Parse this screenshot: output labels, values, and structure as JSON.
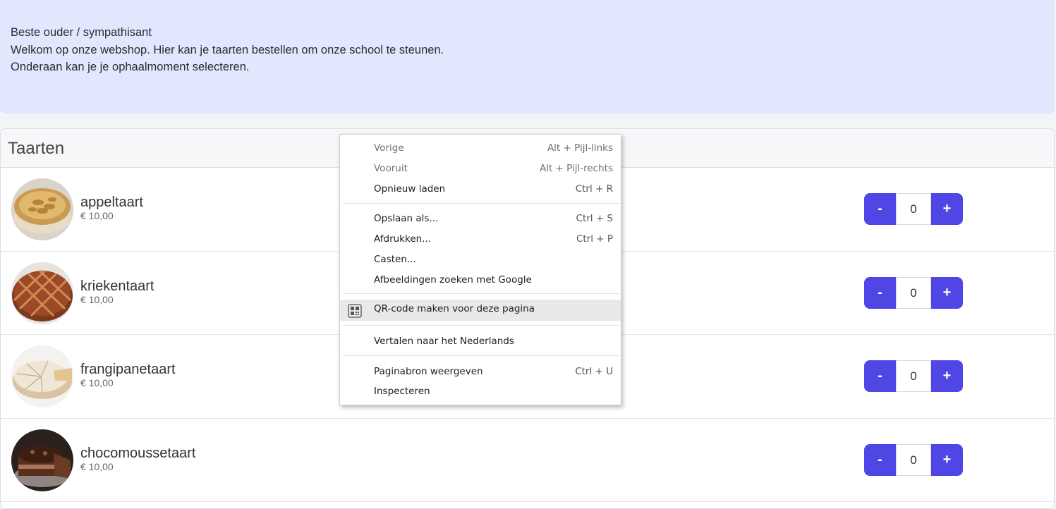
{
  "intro": {
    "lines": [
      "Beste ouder / sympathisant",
      "Welkom op onze webshop. Hier kan je taarten bestellen om onze school te steunen.",
      "Onderaan kan je je ophaalmoment selecteren."
    ]
  },
  "section": {
    "title": "Taarten"
  },
  "products": [
    {
      "name": "appeltaart",
      "price": "€ 10,00",
      "quantity": "0",
      "minus": "-",
      "plus": "+"
    },
    {
      "name": "kriekentaart",
      "price": "€ 10,00",
      "quantity": "0",
      "minus": "-",
      "plus": "+"
    },
    {
      "name": "frangipanetaart",
      "price": "€ 10,00",
      "quantity": "0",
      "minus": "-",
      "plus": "+"
    },
    {
      "name": "chocomoussetaart",
      "price": "€ 10,00",
      "quantity": "0",
      "minus": "-",
      "plus": "+"
    }
  ],
  "colors": {
    "accent": "#4f46e5",
    "banner": "#e0e7ff"
  },
  "context_menu": {
    "items": [
      {
        "label": "Vorige",
        "shortcut": "Alt + Pijl-links",
        "disabled": true
      },
      {
        "label": "Vooruit",
        "shortcut": "Alt + Pijl-rechts",
        "disabled": true
      },
      {
        "label": "Opnieuw laden",
        "shortcut": "Ctrl + R"
      },
      {
        "label": "Opslaan als...",
        "shortcut": "Ctrl + S"
      },
      {
        "label": "Afdrukken...",
        "shortcut": "Ctrl + P"
      },
      {
        "label": "Casten..."
      },
      {
        "label": "Afbeeldingen zoeken met Google"
      },
      {
        "label": "QR-code maken voor deze pagina",
        "icon": "qr-code-icon",
        "highlighted": true
      },
      {
        "label": "Vertalen naar het Nederlands"
      },
      {
        "label": "Paginabron weergeven",
        "shortcut": "Ctrl + U"
      },
      {
        "label": "Inspecteren"
      }
    ]
  }
}
